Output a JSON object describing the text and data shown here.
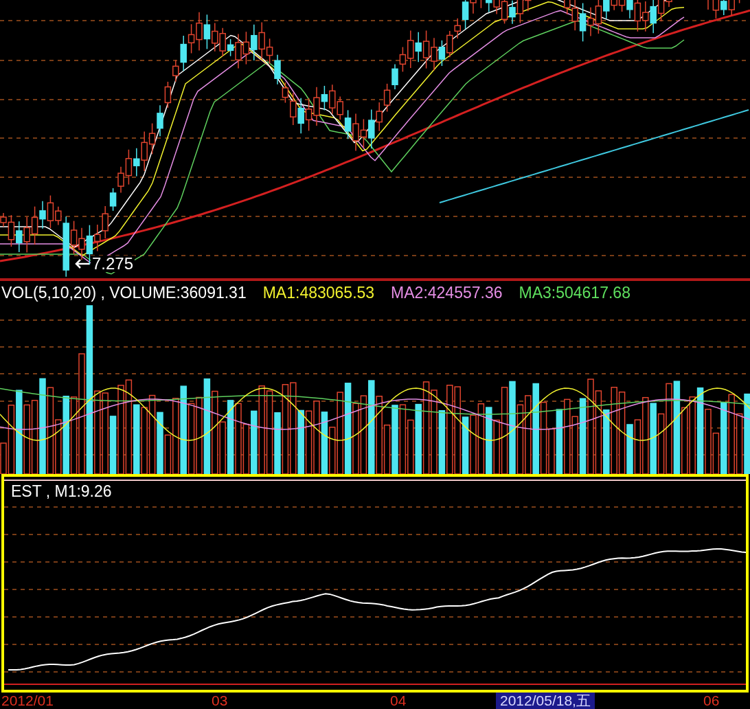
{
  "price_panel": {
    "low_label": "7.275"
  },
  "volume_panel": {
    "legend": [
      {
        "text": "VOL(5,10,20) , VOLUME:36091.31",
        "color": "#ffffff"
      },
      {
        "text": "MA1:483065.53",
        "color": "#f2f22e"
      },
      {
        "text": "MA2:424557.36",
        "color": "#e58ee5"
      },
      {
        "text": "MA3:504617.68",
        "color": "#5ee05e"
      }
    ]
  },
  "indicator_panel": {
    "legend": "EST , M1:9.26"
  },
  "time_axis": [
    {
      "text": "2012/01",
      "kind": "tick"
    },
    {
      "text": "03",
      "kind": "tick"
    },
    {
      "text": "04",
      "kind": "tick"
    },
    {
      "text": "2012/05/18,五",
      "kind": "cursor"
    },
    {
      "text": "06",
      "kind": "tick"
    }
  ]
}
